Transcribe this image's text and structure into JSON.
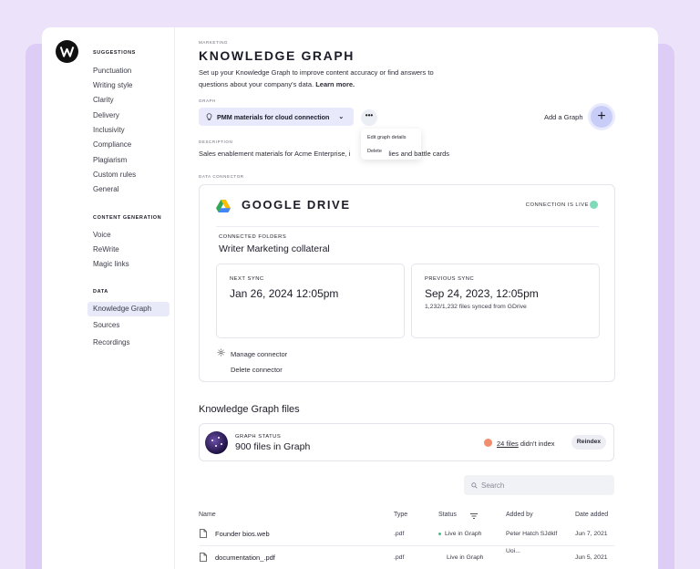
{
  "sidebar": {
    "sections": [
      {
        "title": "SUGGESTIONS",
        "items": [
          "Punctuation",
          "Writing style",
          "Clarity",
          "Delivery",
          "Inclusivity",
          "Compliance",
          "Plagiarism",
          "Custom rules",
          "General"
        ]
      },
      {
        "title": "CONTENT GENERATION",
        "items": [
          "Voice",
          "ReWrite",
          "Magic links"
        ]
      },
      {
        "title": "DATA",
        "items": [
          "Knowledge Graph",
          "Sources",
          "Recordings"
        ]
      }
    ],
    "active_item": "Knowledge Graph"
  },
  "header": {
    "eyebrow": "MARKETING",
    "title": "KNOWLEDGE GRAPH",
    "intro": "Set up your Knowledge Graph to improve content accuracy or find answers to questions about your company's data.",
    "learn_more": "Learn more."
  },
  "graph": {
    "label": "GRAPH",
    "selected": "PMM materials for cloud connection",
    "add_label": "Add a Graph",
    "add_symbol": "+",
    "more_symbol": "•••",
    "menu": [
      "Edit graph details",
      "Delete"
    ]
  },
  "description": {
    "label": "DESCRIPTION",
    "text_before": "Sales enablement materials for Acme Enterprise, i",
    "text_after": "lies and battle cards"
  },
  "connector": {
    "label": "DATA CONNECTOR",
    "name": "GOOGLE DRIVE",
    "status": "CONNECTION IS LIVE",
    "folders_label": "CONNECTED FOLDERS",
    "folders_value": "Writer Marketing collateral",
    "next_sync_label": "NEXT SYNC",
    "next_sync_value": "Jan 26, 2024 12:05pm",
    "prev_sync_label": "PREVIOUS SYNC",
    "prev_sync_value": "Sep 24, 2023, 12:05pm",
    "prev_sync_sub": "1,232/1,232 files synced from GDrive",
    "manage": "Manage connector",
    "delete": "Delete connector",
    "status_color": "#7ddbb8"
  },
  "files": {
    "title": "Knowledge Graph files",
    "status_label": "GRAPH STATUS",
    "status_value": "900 files in Graph",
    "failed_link": "24 files",
    "failed_text": " didn't index",
    "reindex": "Reindex",
    "search_placeholder": "Search",
    "columns": [
      "Name",
      "Type",
      "Status",
      "Added by",
      "Date added"
    ],
    "rows": [
      {
        "name": "Founder bios.web",
        "type": ".pdf",
        "status": "Live in Graph",
        "added_by": "Peter Hatch SJdklf",
        "date": "Jun 7, 2021"
      },
      {
        "name": "documentation_.pdf",
        "type": ".pdf",
        "status": "Live in Graph",
        "added_by": "Uoi...",
        "date": "Jun 5, 2021"
      }
    ]
  }
}
